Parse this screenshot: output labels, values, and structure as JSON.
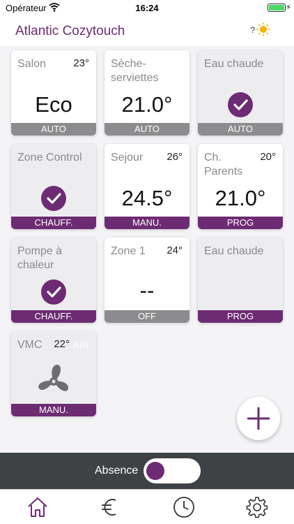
{
  "status_bar": {
    "carrier": "Opérateur",
    "time": "16:24"
  },
  "header": {
    "title": "Atlantic Cozytouch",
    "help": "?"
  },
  "tiles": [
    {
      "name": "Salon",
      "temp": "23°",
      "value": "Eco",
      "footer": "AUTO"
    },
    {
      "name": "Sèche-serviettes",
      "value": "21.0°",
      "footer": "AUTO"
    },
    {
      "name": "Eau chaude",
      "footer": "AUTO"
    },
    {
      "name": "Zone Control",
      "footer": "CHAUFF."
    },
    {
      "name": "Sejour",
      "temp": "26°",
      "value": "24.5°",
      "footer": "MANU."
    },
    {
      "name": "Ch. Parents",
      "temp": "20°",
      "value": "21.0°",
      "footer": "PROG"
    },
    {
      "name": "Pompe à chaleur",
      "footer": "CHAUFF."
    },
    {
      "name": "Zone 1",
      "temp": "24°",
      "value": "--",
      "footer": "OFF"
    },
    {
      "name": "Eau chaude",
      "footer": "PROG"
    },
    {
      "name": "VMC",
      "temp": "22°",
      "extra": "AIR",
      "footer": "MANU."
    }
  ],
  "absence": {
    "label": "Absence",
    "on": false
  },
  "tabs": [
    "home-icon",
    "euro-icon",
    "clock-icon",
    "gear-icon"
  ],
  "colors": {
    "brand": "#6d2b73",
    "gray_footer": "#8c8c8e",
    "absence_bar": "#3f4244"
  }
}
